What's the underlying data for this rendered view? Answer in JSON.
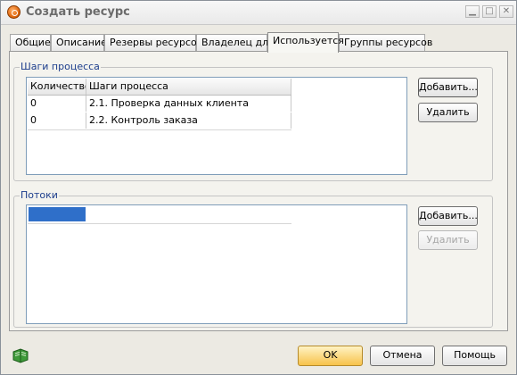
{
  "window": {
    "title": "Создать ресурс"
  },
  "tabs": [
    {
      "label": "Общие",
      "active": false
    },
    {
      "label": "Описание",
      "active": false
    },
    {
      "label": "Резервы ресурсов",
      "active": false
    },
    {
      "label": "Владелец для",
      "active": false
    },
    {
      "label": "Используется",
      "active": true
    },
    {
      "label": "Группы ресурсов",
      "active": false
    }
  ],
  "process_steps": {
    "title": "Шаги процесса",
    "columns": [
      "Количество",
      "Шаги процесса"
    ],
    "rows": [
      {
        "count": "0",
        "step": "2.1. Проверка данных клиента"
      },
      {
        "count": "0",
        "step": "2.2. Контроль заказа"
      }
    ],
    "add_label": "Добавить...",
    "delete_label": "Удалить"
  },
  "flows": {
    "title": "Потоки",
    "add_label": "Добавить...",
    "delete_label": "Удалить"
  },
  "footer": {
    "ok_label": "OK",
    "cancel_label": "Отмена",
    "help_label": "Помощь"
  },
  "colors": {
    "accent": "#2f6fc9",
    "group_title": "#1c3d8c",
    "ok_button": "#f7c24a"
  },
  "icons": {
    "app": "app-logo-icon",
    "help_book": "book-icon"
  }
}
